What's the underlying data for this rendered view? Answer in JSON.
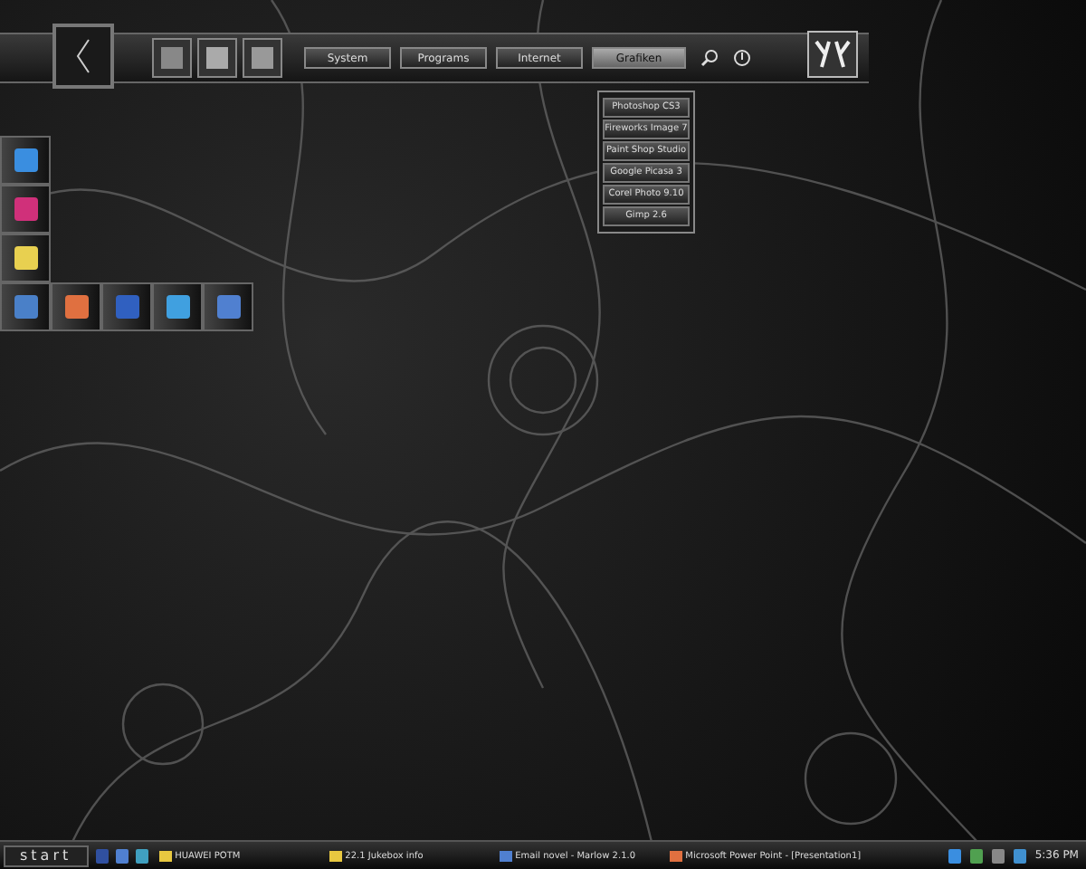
{
  "top_bar": {
    "tabs": [
      {
        "label": "System",
        "selected": false
      },
      {
        "label": "Programs",
        "selected": false
      },
      {
        "label": "Internet",
        "selected": false
      },
      {
        "label": "Grafiken",
        "selected": true
      }
    ]
  },
  "menu": {
    "items": [
      "Photoshop CS3",
      "Fireworks Image 7",
      "Paint Shop Studio",
      "Google Picasa 3",
      "Corel Photo 9.10",
      "Gimp 2.6"
    ]
  },
  "taskbar": {
    "start": "start",
    "tasks": [
      {
        "label": "HUAWEI POTM",
        "kind": "folder"
      },
      {
        "label": "22.1 Jukebox info",
        "kind": "folder"
      },
      {
        "label": "Email novel - Marlow 2.1.0",
        "kind": "app"
      },
      {
        "label": "Microsoft Power Point - [Presentation1]",
        "kind": "doc"
      }
    ],
    "clock": "5:36 PM"
  }
}
